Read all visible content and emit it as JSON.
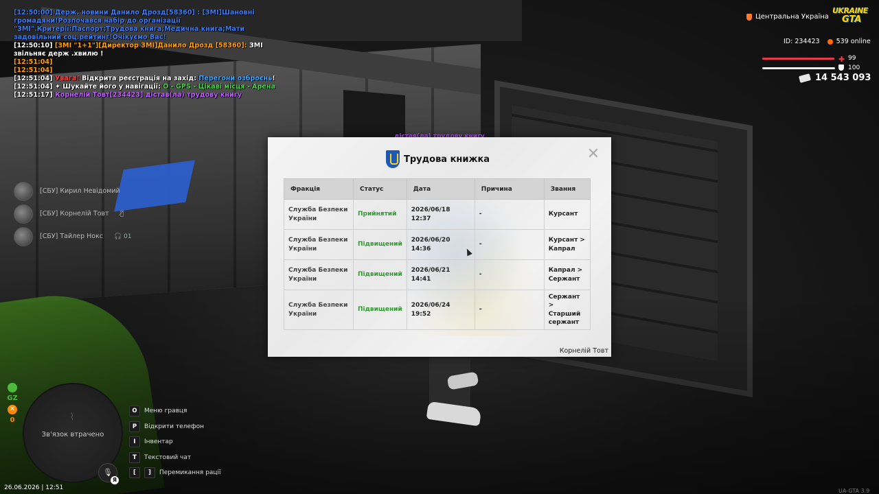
{
  "chat": [
    {
      "parts": [
        {
          "c": "c-blue",
          "t": "[12:50:00] Держ. новини Данило Дрозд[58360] : [ЗМІ]Шановні громадяни!Розпочався набір до організації \"ЗМІ\".Критерії:Паспорт;Трудова книга;Медична книга;Мати задовільний соц.рейтинг!Очікуємо Вас!"
        }
      ]
    },
    {
      "parts": [
        {
          "c": "c-white",
          "t": "[12:50:10] "
        },
        {
          "c": "c-orange",
          "t": "[ЗМІ \"1+1\"][Директор ЗМІ]Данило Дрозд [58360]: "
        },
        {
          "c": "c-white",
          "t": "ЗМІ звільняє держ .хвилю !"
        }
      ]
    },
    {
      "parts": [
        {
          "c": "c-orange",
          "t": "[12:51:04]"
        }
      ]
    },
    {
      "parts": [
        {
          "c": "c-orange",
          "t": "[12:51:04]"
        }
      ]
    },
    {
      "parts": [
        {
          "c": "c-white",
          "t": "[12:51:04] "
        },
        {
          "c": "c-red",
          "t": "Увага! "
        },
        {
          "c": "c-white",
          "t": "Відкрита реєстрація на захід: "
        },
        {
          "c": "c-cyan",
          "t": "Перегони озброєнь"
        },
        {
          "c": "c-white",
          "t": "!"
        }
      ]
    },
    {
      "parts": [
        {
          "c": "c-white",
          "t": "[12:51:04] ✦ Шукайте його у навігації: "
        },
        {
          "c": "c-green",
          "t": "O - GPS - Цікаві місця - Арена"
        }
      ]
    },
    {
      "parts": [
        {
          "c": "c-white",
          "t": "[12:51:17] "
        },
        {
          "c": "c-purple",
          "t": "Корнелій Товт[234423] дістав(ла) трудову книгу"
        }
      ]
    }
  ],
  "hud": {
    "region": "Центральна Україна",
    "logo_top": "UKRAINE",
    "logo_bottom": "GTA",
    "id_label": "ID: 234423",
    "online": "539 online",
    "health": "99",
    "armor": "100",
    "money": "14 543 093",
    "health_fill": 0.99,
    "armor_fill": 1.0,
    "colors": {
      "health": "#e8394a",
      "armor": "#f0f0f0",
      "online": "#ff6a00"
    }
  },
  "players": [
    {
      "name": "[СБУ] Кирил Невідомий",
      "extra": ""
    },
    {
      "name": "[СБУ] Корнелій Товт",
      "extra": "mic-off"
    },
    {
      "name": "[СБУ] Тайлер Нокс",
      "extra": "01"
    }
  ],
  "status": {
    "gz": "GZ",
    "zero": "0"
  },
  "minimap": {
    "text": "Зв'язок втрачено",
    "lang": "Я",
    "datetime": "26.06.2026 | 12:51"
  },
  "hints": [
    {
      "key": "O",
      "label": "Меню гравця"
    },
    {
      "key": "P",
      "label": "Відкрити телефон"
    },
    {
      "key": "I",
      "label": "Інвентар"
    },
    {
      "key": "T",
      "label": "Текстовий чат"
    },
    {
      "key": "[",
      "key2": "]",
      "label": "Перемикання рації"
    }
  ],
  "version": "UA-GTA 3.9",
  "floating_text": "дістав(ла) трудову книгу",
  "modal": {
    "title": "Трудова книжка",
    "columns": [
      "Фракція",
      "Статус",
      "Дата",
      "Причина",
      "Звання"
    ],
    "rows": [
      {
        "faction": "Служба Безпеки України",
        "status": "Прийнятий",
        "date": "2026/06/18 12:37",
        "reason": "-",
        "rank": "Курсант"
      },
      {
        "faction": "Служба Безпеки України",
        "status": "Підвищений",
        "date": "2026/06/20 14:36",
        "reason": "-",
        "rank": "Курсант > Капрал"
      },
      {
        "faction": "Служба Безпеки України",
        "status": "Підвищений",
        "date": "2026/06/21 14:41",
        "reason": "-",
        "rank": "Капрал > Сержант"
      },
      {
        "faction": "Служба Безпеки України",
        "status": "Підвищений",
        "date": "2026/06/24 19:52",
        "reason": "-",
        "rank": "Сержант > Старший сержант"
      }
    ],
    "signature": "Корнелій Товт",
    "close": "✕"
  }
}
